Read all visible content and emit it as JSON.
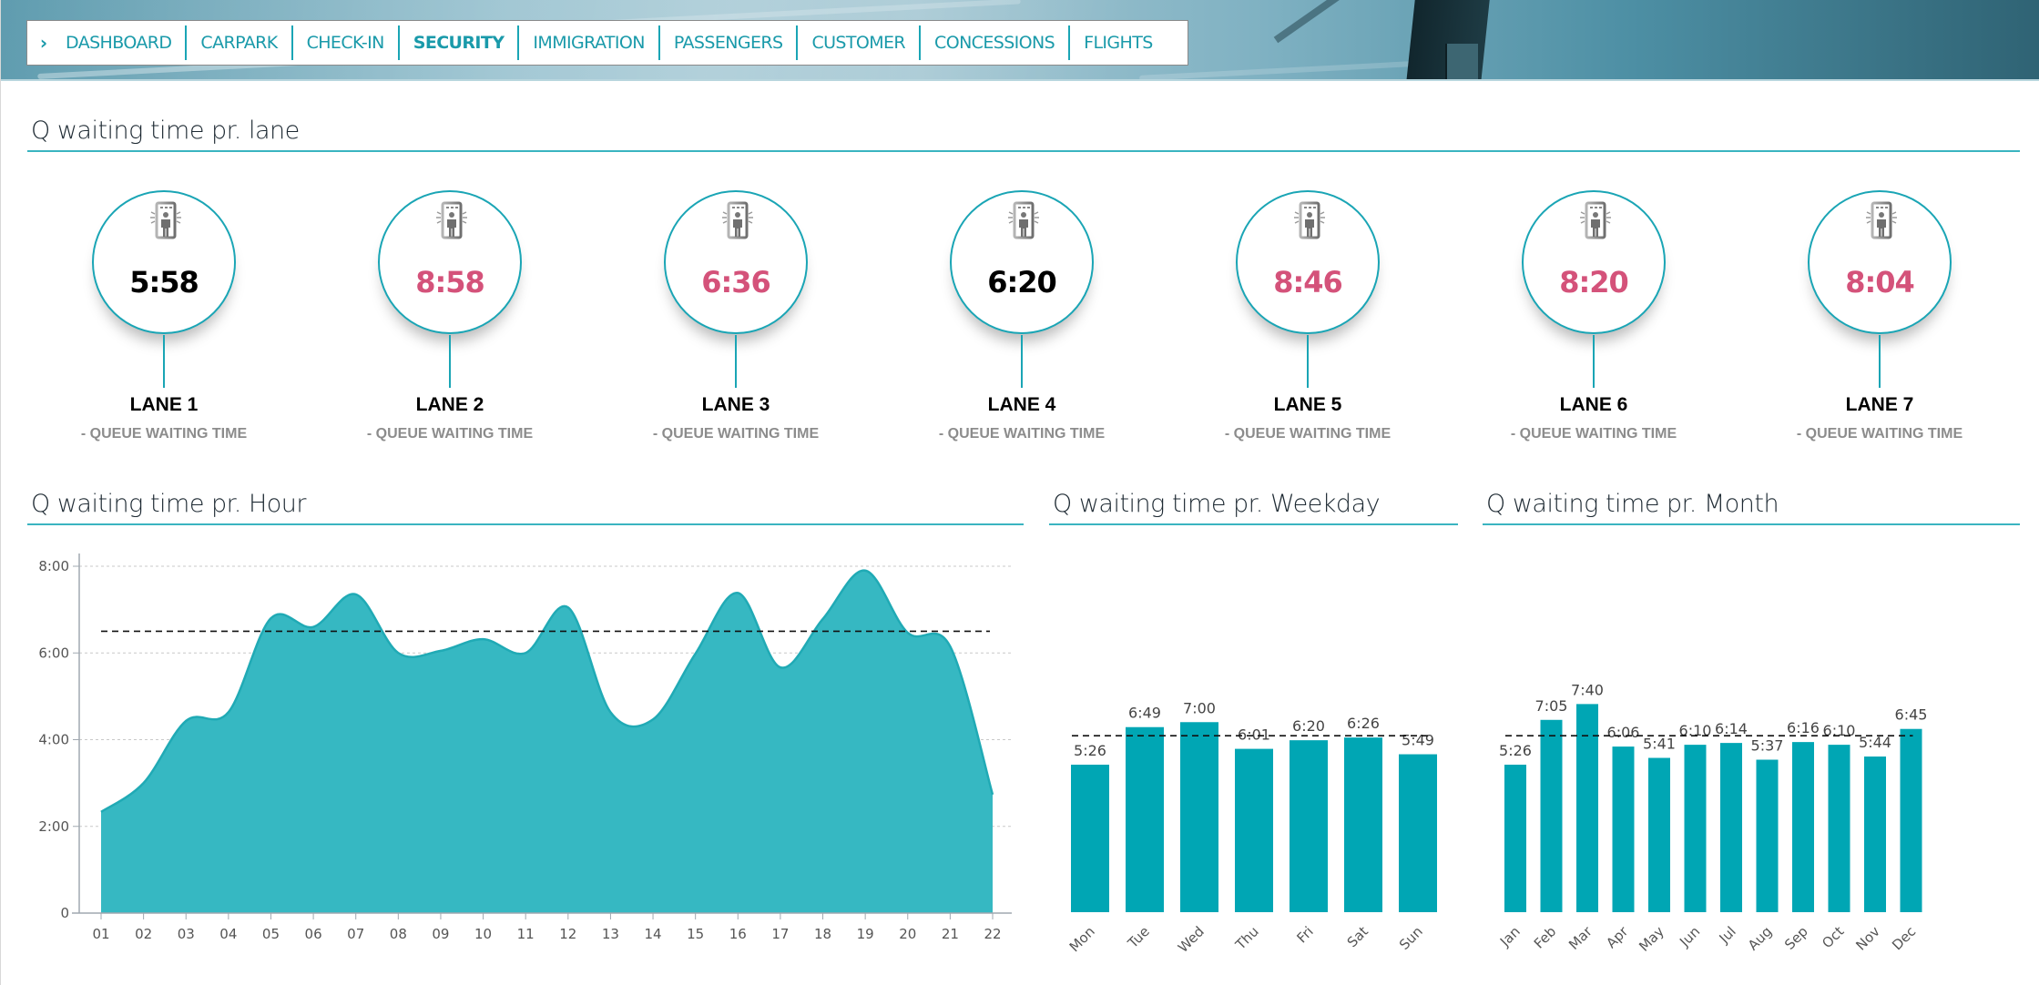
{
  "nav": {
    "items": [
      {
        "label": "DASHBOARD",
        "active": false
      },
      {
        "label": "CARPARK",
        "active": false
      },
      {
        "label": "CHECK-IN",
        "active": false
      },
      {
        "label": "SECURITY",
        "active": true
      },
      {
        "label": "IMMIGRATION",
        "active": false
      },
      {
        "label": "PASSENGERS",
        "active": false
      },
      {
        "label": "CUSTOMER",
        "active": false
      },
      {
        "label": "CONCESSIONS",
        "active": false
      },
      {
        "label": "FLIGHTS",
        "active": false
      }
    ]
  },
  "colors": {
    "accent": "#1aa5b5",
    "bar": "#00a6b4",
    "area": "#36b8c2",
    "alert": "#d4527a",
    "normal": "#000000"
  },
  "lanes_section": {
    "title": "Q waiting time pr. lane",
    "icon": "security-scanner-icon",
    "lanes": [
      {
        "label": "LANE 1",
        "sub": "- QUEUE WAITING TIME",
        "value": "5:58",
        "status": "normal"
      },
      {
        "label": "LANE 2",
        "sub": "- QUEUE WAITING TIME",
        "value": "8:58",
        "status": "alert"
      },
      {
        "label": "LANE 3",
        "sub": "- QUEUE WAITING TIME",
        "value": "6:36",
        "status": "alert"
      },
      {
        "label": "LANE 4",
        "sub": "- QUEUE WAITING TIME",
        "value": "6:20",
        "status": "normal"
      },
      {
        "label": "LANE 5",
        "sub": "- QUEUE WAITING TIME",
        "value": "8:46",
        "status": "alert"
      },
      {
        "label": "LANE 6",
        "sub": "- QUEUE WAITING TIME",
        "value": "8:20",
        "status": "alert"
      },
      {
        "label": "LANE 7",
        "sub": "- QUEUE WAITING TIME",
        "value": "8:04",
        "status": "alert"
      }
    ]
  },
  "chart_data": [
    {
      "type": "area",
      "title": "Q waiting time pr. Hour",
      "xlabel": "",
      "ylabel": "",
      "unit": "minutes",
      "x": [
        "01",
        "02",
        "03",
        "04",
        "05",
        "06",
        "07",
        "08",
        "09",
        "10",
        "11",
        "12",
        "13",
        "14",
        "15",
        "16",
        "17",
        "18",
        "19",
        "20",
        "21",
        "22"
      ],
      "values": [
        140,
        180,
        266,
        278,
        408,
        396,
        441,
        360,
        363,
        379,
        360,
        423,
        278,
        268,
        359,
        443,
        340,
        407,
        474,
        388,
        369,
        164
      ],
      "average": 390,
      "ylim": [
        0,
        480
      ],
      "yticks": [
        0,
        120,
        240,
        360,
        480
      ],
      "ytick_labels": [
        "0",
        "2:00",
        "4:00",
        "6:00",
        "8:00"
      ],
      "grid": true
    },
    {
      "type": "bar",
      "title": "Q waiting time pr. Weekday",
      "categories": [
        "Mon",
        "Tue",
        "Wed",
        "Thu",
        "Fri",
        "Sat",
        "Sun"
      ],
      "labels": [
        "5:26",
        "6:49",
        "7:00",
        "6:01",
        "6:20",
        "6:26",
        "5:49"
      ],
      "values": [
        326,
        409,
        420,
        361,
        380,
        386,
        349
      ],
      "average": 390,
      "ylim": [
        0,
        600
      ],
      "grid": false
    },
    {
      "type": "bar",
      "title": "Q waiting time pr. Month",
      "categories": [
        "Jan",
        "Feb",
        "Mar",
        "Apr",
        "May",
        "Jun",
        "Jul",
        "Aug",
        "Sep",
        "Oct",
        "Nov",
        "Dec"
      ],
      "labels": [
        "5:26",
        "7:05",
        "7:40",
        "6:06",
        "5:41",
        "6:10",
        "6:14",
        "5:37",
        "6:16",
        "6:10",
        "5:44",
        "6:45"
      ],
      "values": [
        326,
        425,
        460,
        366,
        341,
        370,
        374,
        337,
        376,
        370,
        344,
        405
      ],
      "average": 390,
      "ylim": [
        0,
        600
      ],
      "grid": false
    }
  ]
}
